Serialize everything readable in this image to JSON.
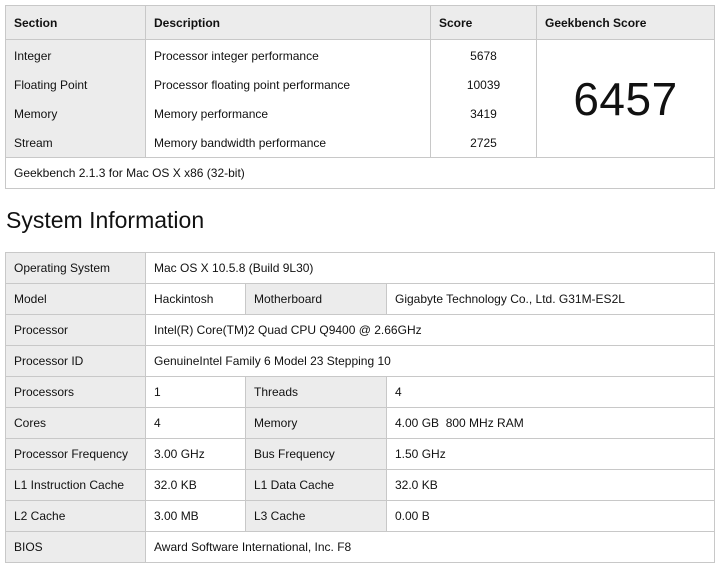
{
  "summary": {
    "headers": {
      "section": "Section",
      "description": "Description",
      "score": "Score",
      "geekbench": "Geekbench Score"
    },
    "rows": [
      {
        "section": "Integer",
        "description": "Processor integer performance",
        "score": "5678"
      },
      {
        "section": "Floating Point",
        "description": "Processor floating point performance",
        "score": "10039"
      },
      {
        "section": "Memory",
        "description": "Memory performance",
        "score": "3419"
      },
      {
        "section": "Stream",
        "description": "Memory bandwidth performance",
        "score": "2725"
      }
    ],
    "geekbench_score": "6457",
    "footer": "Geekbench 2.1.3 for Mac OS X x86 (32-bit)"
  },
  "system_information": {
    "title": "System Information",
    "operating_system": {
      "label": "Operating System",
      "value": "Mac OS X 10.5.8 (Build 9L30)"
    },
    "model": {
      "label": "Model",
      "value": "Hackintosh"
    },
    "motherboard": {
      "label": "Motherboard",
      "value": "Gigabyte Technology Co., Ltd. G31M-ES2L"
    },
    "processor": {
      "label": "Processor",
      "value": "Intel(R) Core(TM)2 Quad CPU Q9400 @ 2.66GHz"
    },
    "processor_id": {
      "label": "Processor ID",
      "value": "GenuineIntel Family 6 Model 23 Stepping 10"
    },
    "processors": {
      "label": "Processors",
      "value": "1"
    },
    "threads": {
      "label": "Threads",
      "value": "4"
    },
    "cores": {
      "label": "Cores",
      "value": "4"
    },
    "memory": {
      "label": "Memory",
      "value": "4.00 GB  800 MHz RAM"
    },
    "processor_frequency": {
      "label": "Processor Frequency",
      "value": "3.00 GHz"
    },
    "bus_frequency": {
      "label": "Bus Frequency",
      "value": "1.50 GHz"
    },
    "l1_instruction_cache": {
      "label": "L1 Instruction Cache",
      "value": "32.0 KB"
    },
    "l1_data_cache": {
      "label": "L1 Data Cache",
      "value": "32.0 KB"
    },
    "l2_cache": {
      "label": "L2 Cache",
      "value": "3.00 MB"
    },
    "l3_cache": {
      "label": "L3 Cache",
      "value": "0.00 B"
    },
    "bios": {
      "label": "BIOS",
      "value": "Award Software International, Inc. F8"
    }
  }
}
